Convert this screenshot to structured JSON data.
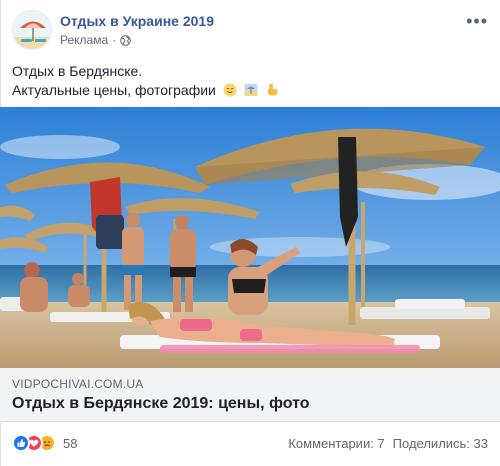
{
  "header": {
    "page_name": "Отдых в Украине 2019",
    "sponsored": "Реклама",
    "separator": "·",
    "more_icon": "more-dots-icon"
  },
  "post": {
    "line1": "Отдых в Бердянске.",
    "line2": "Актуальные цены, фотографии"
  },
  "link": {
    "domain": "VIDPOCHIVAI.COM.UA",
    "title": "Отдых в Бердянске 2019: цены, фото"
  },
  "footer": {
    "reaction_count": "58",
    "comments": "Комментарии: 7",
    "shares": "Поделились: 33"
  },
  "colors": {
    "brand_blue": "#385898",
    "like_blue": "#1877f2",
    "love_red": "#f33e58",
    "sad_yellow": "#f7b125"
  }
}
